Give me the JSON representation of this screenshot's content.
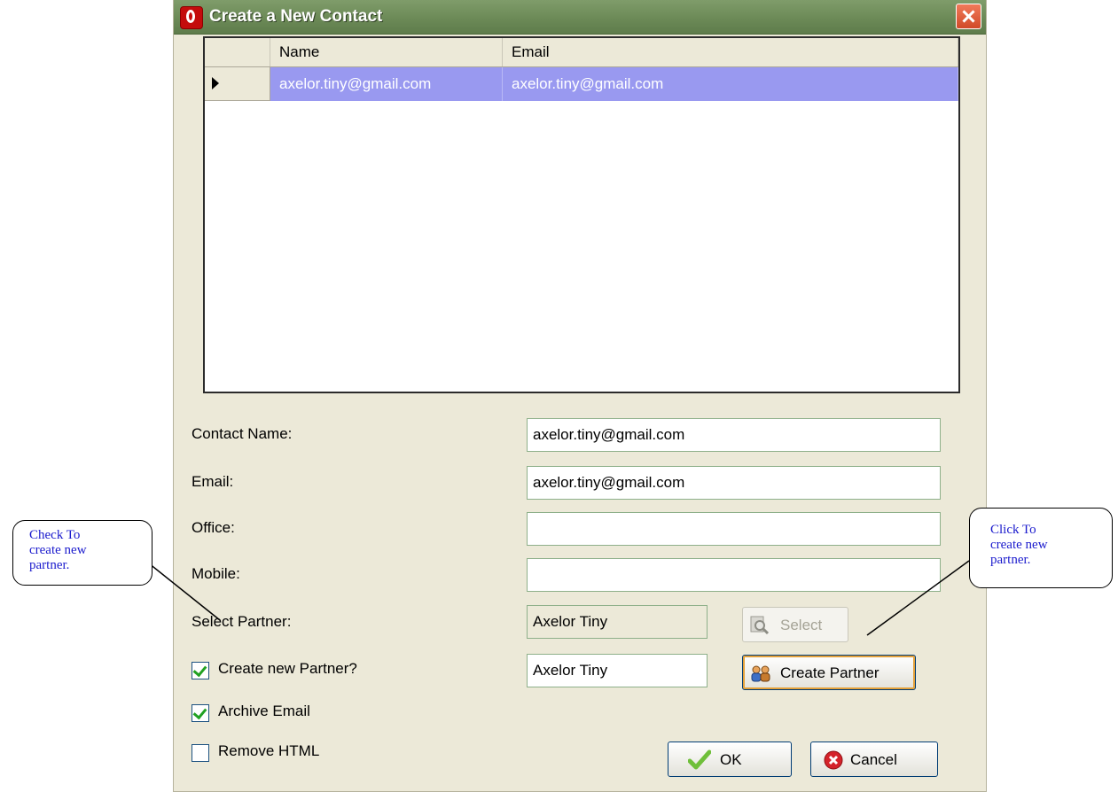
{
  "dialog": {
    "title": "Create a New Contact",
    "columns": [
      "Name",
      "Email"
    ],
    "rows": [
      {
        "name": "axelor.tiny@gmail.com",
        "email": "axelor.tiny@gmail.com"
      }
    ]
  },
  "form": {
    "contact_name_label": "Contact Name:",
    "contact_name_value": "axelor.tiny@gmail.com",
    "email_label": "Email:",
    "email_value": "axelor.tiny@gmail.com",
    "office_label": "Office:",
    "office_value": "",
    "mobile_label": "Mobile:",
    "mobile_value": "",
    "select_partner_label": "Select Partner:",
    "select_partner_value": "Axelor Tiny",
    "select_button": "Select",
    "create_partner_check_label": "Create new Partner?",
    "create_partner_checked": true,
    "new_partner_value": "Axelor Tiny",
    "create_partner_button": "Create Partner",
    "archive_email_label": "Archive Email",
    "archive_email_checked": true,
    "remove_html_label": "Remove HTML",
    "remove_html_checked": false,
    "ok_button": "OK",
    "cancel_button": "Cancel"
  },
  "callouts": {
    "left": [
      "Check To",
      "create new",
      "partner."
    ],
    "right": [
      "Click To",
      "create new",
      "partner."
    ]
  },
  "colors": {
    "titlebar": "#6c8a57",
    "selection": "#9999f0",
    "callout_text": "#1a1acd"
  }
}
